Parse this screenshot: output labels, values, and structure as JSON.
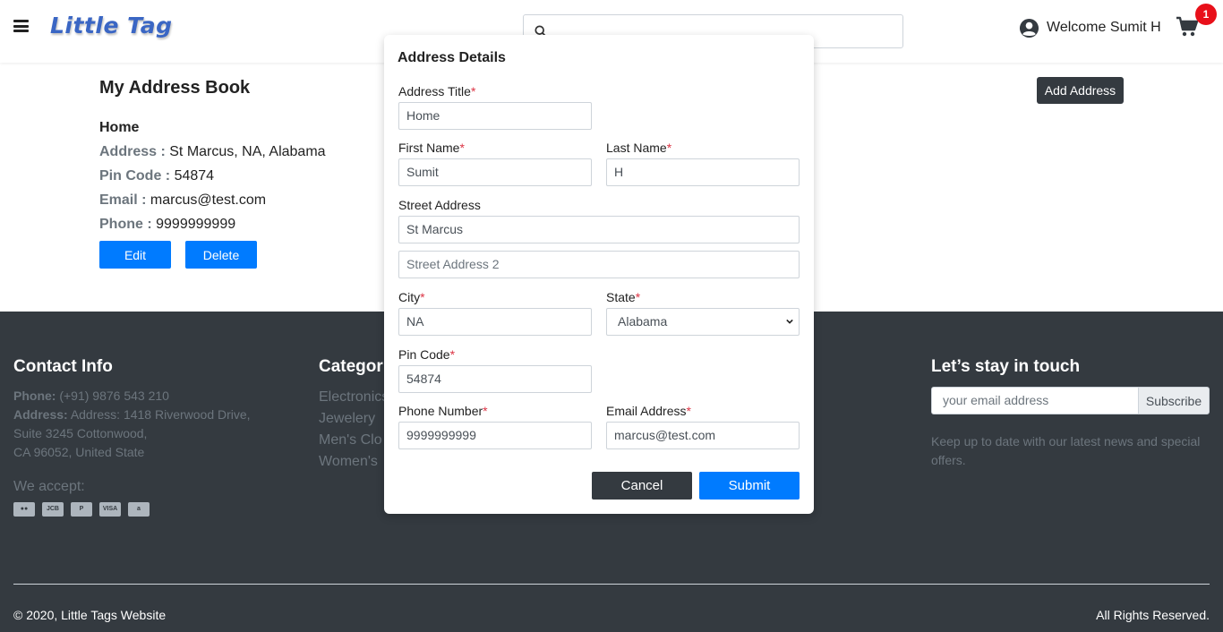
{
  "header": {
    "logo": "Little Tag",
    "search_placeholder": "",
    "welcome": "Welcome Sumit H",
    "cart_count": "1"
  },
  "address_book": {
    "title": "My Address Book",
    "add_button": "Add Address",
    "entry": {
      "title": "Home",
      "address_label": "Address :",
      "address_value": "St Marcus, NA, Alabama",
      "pin_label": "Pin Code :",
      "pin_value": "54874",
      "email_label": "Email :",
      "email_value": "marcus@test.com",
      "phone_label": "Phone :",
      "phone_value": "9999999999",
      "edit_button": "Edit",
      "delete_button": "Delete"
    }
  },
  "modal": {
    "title": "Address Details",
    "required_mark": "*",
    "address_title_label": "Address Title",
    "address_title_value": "Home",
    "first_name_label": "First Name",
    "first_name_value": "Sumit",
    "last_name_label": "Last Name",
    "last_name_value": "H",
    "street_label": "Street Address",
    "street_value": "St Marcus",
    "street2_placeholder": "Street Address 2",
    "city_label": "City",
    "city_value": "NA",
    "state_label": "State",
    "state_value": "Alabama",
    "pin_label": "Pin Code",
    "pin_value": "54874",
    "phone_label": "Phone Number",
    "phone_value": "9999999999",
    "email_label": "Email Address",
    "email_value": "marcus@test.com",
    "cancel_button": "Cancel",
    "submit_button": "Submit"
  },
  "footer": {
    "contact_heading": "Contact Info",
    "phone_label": "Phone:",
    "phone_value": "(+91) 9876 543 210",
    "address_label": "Address:",
    "address_line1": "Address: 1418 Riverwood Drive,",
    "address_line2": "Suite 3245 Cottonwood,",
    "address_line3": "CA 96052, United State",
    "we_accept": "We accept:",
    "cards": [
      "mastercard",
      "jcb",
      "paypal",
      "VISA",
      "amazon"
    ],
    "categories_heading": "Categor",
    "categories": [
      "Electronics",
      "Jewelery",
      "Men's Clo",
      "Women's"
    ],
    "newsletter_heading": "Let’s stay in touch",
    "newsletter_placeholder": "your email address",
    "subscribe_button": "Subscribe",
    "newsletter_text_line1": "Keep up to date with our latest news and special",
    "newsletter_text_line2": "offers.",
    "copyright": "© 2020, Little Tags Website",
    "rights": "All Rights Reserved."
  },
  "colors": {
    "primary": "#007bff",
    "dark": "#343a40",
    "badge": "#e8101a",
    "required": "#dc3545",
    "logo": "#3a66c4"
  }
}
